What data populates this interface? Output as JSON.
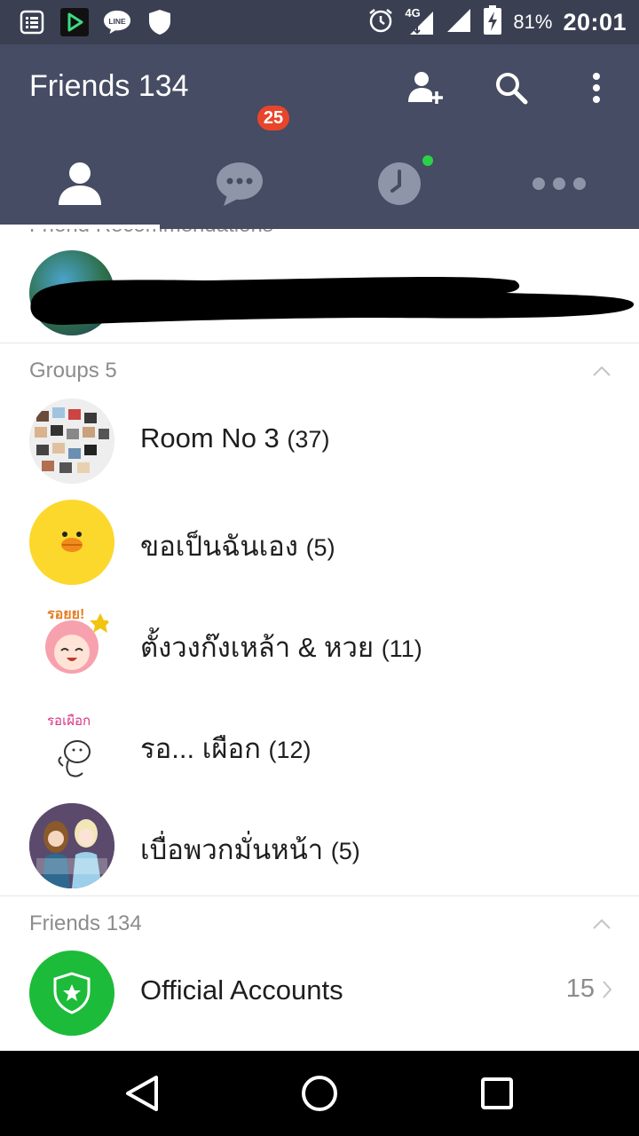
{
  "status_bar": {
    "notification_icons": [
      "list-icon",
      "play-store-icon",
      "line-icon",
      "shield-icon"
    ],
    "system_icons": [
      "alarm-icon",
      "network-4g-icon",
      "signal-icon",
      "battery-charging-icon"
    ],
    "network_label": "4G",
    "battery": "81%",
    "time": "20:01"
  },
  "app_bar": {
    "title": "Friends 134",
    "actions": [
      "add-friend-icon",
      "search-icon",
      "more-vert-icon"
    ],
    "background_color": "#454c63"
  },
  "tabs": [
    {
      "icon": "person-icon",
      "selected": true
    },
    {
      "icon": "chat-icon",
      "selected": false,
      "badge": "25"
    },
    {
      "icon": "clock-icon",
      "selected": false,
      "has_dot": true
    },
    {
      "icon": "more-horiz-icon",
      "selected": false
    }
  ],
  "recommendations": {
    "header": "Friend Recommendations"
  },
  "groups": {
    "header": "Groups 5",
    "items": [
      {
        "name": "Room No 3",
        "count": "(37)"
      },
      {
        "name": "ขอเป็นฉันเอง",
        "count": "(5)"
      },
      {
        "name": "ตั้งวงก๊งเหล้า & หวย",
        "count": "(11)"
      },
      {
        "name": "รอ... เผือก ",
        "count": "(12)"
      },
      {
        "name": "เบื่อพวกมั่นหน้า ",
        "count": "(5)"
      }
    ]
  },
  "friends": {
    "header": "Friends 134",
    "official_accounts": {
      "label": "Official Accounts",
      "count": "15"
    }
  },
  "colors": {
    "badge": "#e8452b",
    "online_dot": "#2bd148",
    "official_green": "#1dbb3a",
    "sally_yellow": "#fcd82c"
  }
}
